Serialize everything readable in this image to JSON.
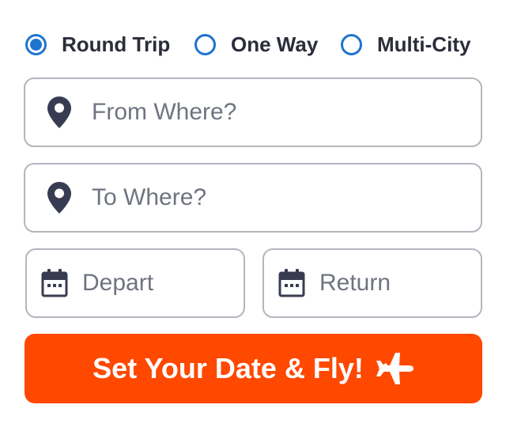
{
  "trip_types": [
    {
      "label": "Round Trip",
      "selected": true
    },
    {
      "label": "One Way",
      "selected": false
    },
    {
      "label": "Multi-City",
      "selected": false
    }
  ],
  "from": {
    "placeholder": "From Where?",
    "value": "",
    "icon": "map-pin-icon"
  },
  "to": {
    "placeholder": "To Where?",
    "value": "",
    "icon": "map-pin-icon"
  },
  "depart": {
    "placeholder": "Depart",
    "value": "",
    "icon": "calendar-icon"
  },
  "return": {
    "placeholder": "Return",
    "value": "",
    "icon": "calendar-icon"
  },
  "submit": {
    "label": "Set Your Date & Fly!",
    "icon": "airplane-icon"
  },
  "colors": {
    "accent": "#1f74cf",
    "cta": "#ff4800",
    "text": "#2a2d3a",
    "placeholder": "#6f7480",
    "border": "#b4b6be",
    "icon": "#383c52"
  }
}
